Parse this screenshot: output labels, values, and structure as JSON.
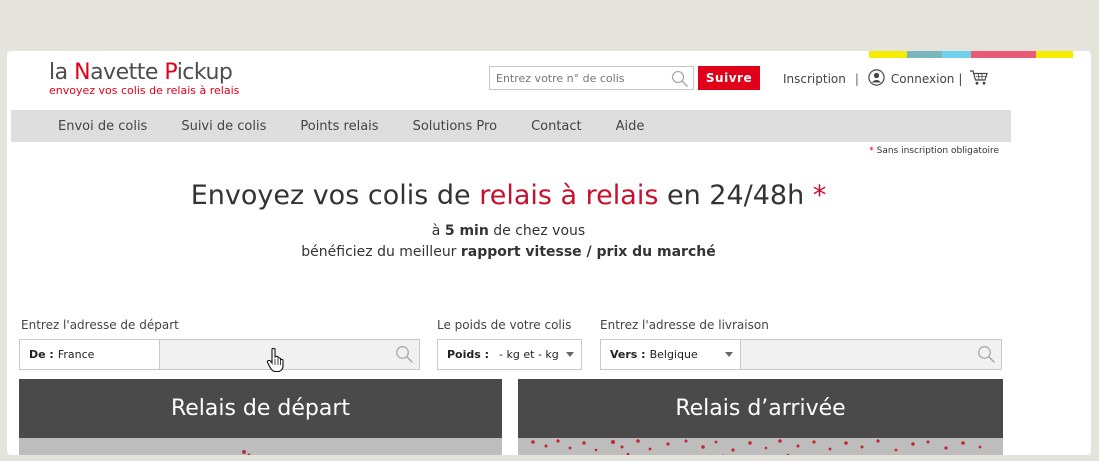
{
  "brand": {
    "logo_part1": "la ",
    "logo_n": "N",
    "logo_part2": "avette ",
    "logo_p": "P",
    "logo_part3": "ickup",
    "tagline": "envoyez vos colis de relais à relais",
    "accent_color": "#e0001a",
    "stripe_colors": [
      "#f5ec00",
      "#7bb6bc",
      "#6fd3ee",
      "#ea5a74",
      "#ea5a74",
      "#f5ec00"
    ]
  },
  "header": {
    "tracking_placeholder": "Entrez votre n° de colis",
    "track_button": "Suivre",
    "inscription": "Inscription",
    "sep1": "|",
    "connexion": "Connexion",
    "sep2": "|",
    "icons": [
      "search-icon",
      "user-icon",
      "cart-icon"
    ]
  },
  "nav": {
    "items": [
      "Envoi de colis",
      "Suivi de colis",
      "Points relais",
      "Solutions Pro",
      "Contact",
      "Aide"
    ]
  },
  "note": {
    "star": "*",
    "text": " Sans inscription obligatoire"
  },
  "hero": {
    "title_a": "Envoyez vos colis de ",
    "title_red": "relais à relais",
    "title_b": " en 24/48h ",
    "title_star": "*",
    "sub1_a": "à ",
    "sub1_bold": "5 min",
    "sub1_b": " de chez vous",
    "sub2_a": "bénéficiez du meilleur ",
    "sub2_bold": "rapport vitesse / prix du marché"
  },
  "form": {
    "depart_label": "Entrez l'adresse de départ",
    "depart_prefix": "De :",
    "depart_country": "France",
    "poids_label": "Le poids de votre colis",
    "poids_prefix": "Poids :",
    "poids_value": "- kg et - kg",
    "livraison_label": "Entrez l'adresse de livraison",
    "livraison_prefix": "Vers :",
    "livraison_country": "Belgique"
  },
  "panels": {
    "depart_title": "Relais de départ",
    "arrivee_title": "Relais d’arrivée"
  }
}
